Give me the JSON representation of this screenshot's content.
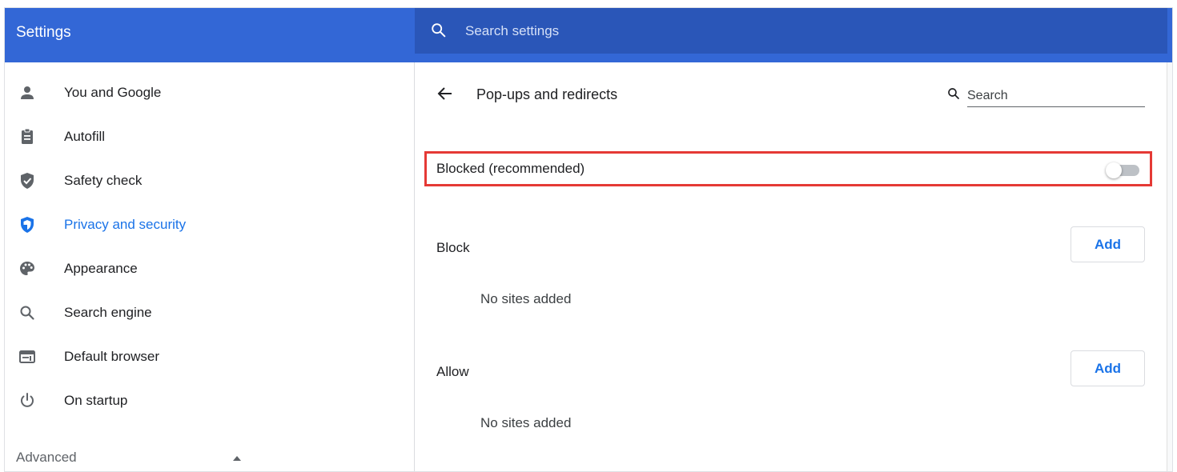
{
  "header": {
    "title": "Settings"
  },
  "search": {
    "placeholder": "Search settings"
  },
  "sidebar": {
    "items": [
      {
        "label": "You and Google",
        "icon": "person-icon"
      },
      {
        "label": "Autofill",
        "icon": "clipboard-icon"
      },
      {
        "label": "Safety check",
        "icon": "shield-check-icon"
      },
      {
        "label": "Privacy and security",
        "icon": "shield-icon",
        "active": true
      },
      {
        "label": "Appearance",
        "icon": "palette-icon"
      },
      {
        "label": "Search engine",
        "icon": "search-icon"
      },
      {
        "label": "Default browser",
        "icon": "browser-icon"
      },
      {
        "label": "On startup",
        "icon": "power-icon"
      }
    ],
    "advanced": {
      "label": "Advanced",
      "expanded": true
    }
  },
  "content": {
    "title": "Pop-ups and redirects",
    "search_placeholder": "Search",
    "toggle": {
      "label": "Blocked (recommended)",
      "enabled": false
    },
    "block": {
      "label": "Block",
      "add_label": "Add",
      "empty": "No sites added"
    },
    "allow": {
      "label": "Allow",
      "add_label": "Add",
      "empty": "No sites added"
    }
  },
  "colors": {
    "header_bg": "#3367d6",
    "search_bg": "#2a56b8",
    "accent": "#1a73e8",
    "highlight_border": "#e53935"
  }
}
